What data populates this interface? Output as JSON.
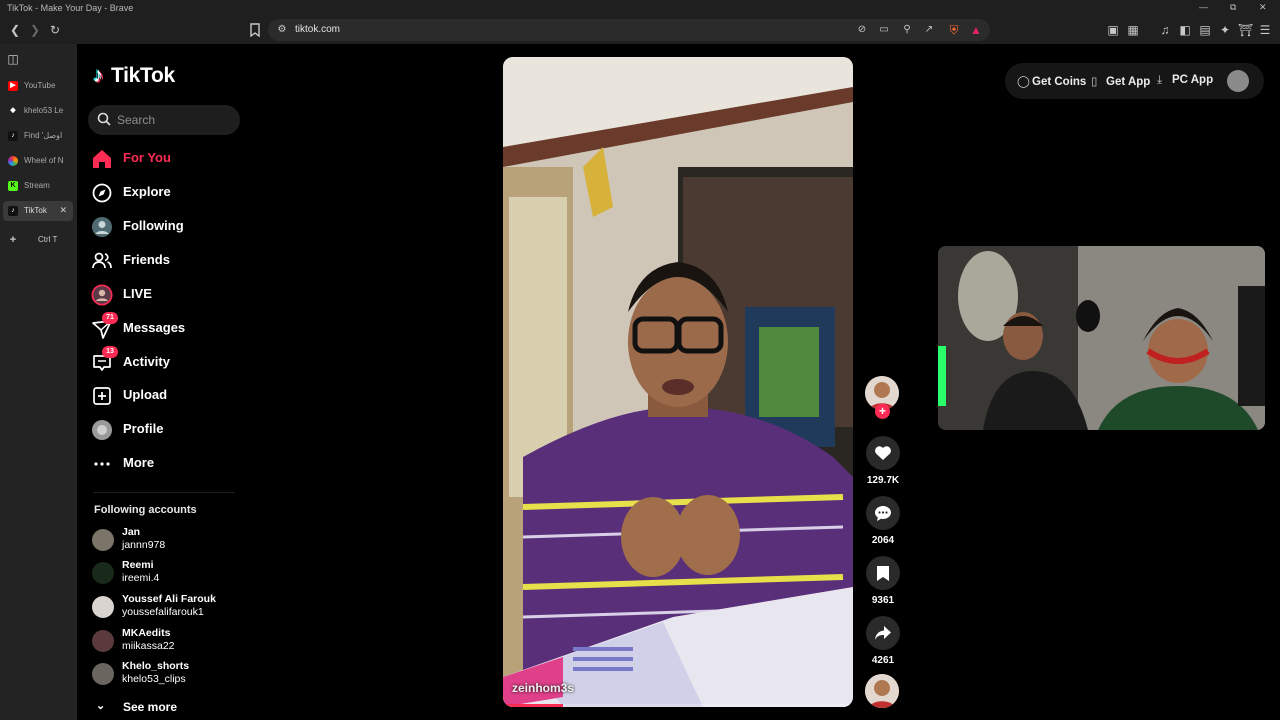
{
  "window": {
    "title": "TikTok - Make Your Day - Brave"
  },
  "browser": {
    "url": "tiktok.com",
    "tabs": [
      {
        "label": "YouTube",
        "favicon": "youtube-icon",
        "color": "#ff0000"
      },
      {
        "label": "khelo53 Le",
        "favicon": "diamond-icon",
        "color": "#ffffff"
      },
      {
        "label": "Find 'اوصل",
        "favicon": "tiktok-icon",
        "color": "#000000"
      },
      {
        "label": "Wheel of N",
        "favicon": "wheel-icon",
        "color": "#ff9800"
      },
      {
        "label": "Stream",
        "favicon": "kick-icon",
        "color": "#53fc18"
      },
      {
        "label": "TikTok",
        "favicon": "tiktok-icon",
        "color": "#000000",
        "active": true
      }
    ],
    "new_tab": {
      "plus": "+",
      "shortcut": "Ctrl T"
    }
  },
  "sidebar": {
    "logo": "TikTok",
    "search_placeholder": "Search",
    "nav": [
      {
        "label": "For You",
        "icon": "home-icon",
        "active": true
      },
      {
        "label": "Explore",
        "icon": "compass-icon"
      },
      {
        "label": "Following",
        "icon": "following-avatar-icon"
      },
      {
        "label": "Friends",
        "icon": "friends-icon"
      },
      {
        "label": "LIVE",
        "icon": "live-icon"
      },
      {
        "label": "Messages",
        "icon": "messages-icon",
        "badge": "71"
      },
      {
        "label": "Activity",
        "icon": "activity-icon",
        "badge": "13"
      },
      {
        "label": "Upload",
        "icon": "upload-icon"
      },
      {
        "label": "Profile",
        "icon": "profile-avatar-icon"
      },
      {
        "label": "More",
        "icon": "more-icon"
      }
    ],
    "following_title": "Following accounts",
    "following": [
      {
        "name": "Jan",
        "handle": "jannn978",
        "color": "#7b7468"
      },
      {
        "name": "Reemi",
        "handle": "ireemi.4",
        "color": "#1a2a1a"
      },
      {
        "name": "Youssef Ali Farouk",
        "handle": "youssefalifarouk1",
        "color": "#d9d4cf"
      },
      {
        "name": "MKAedits",
        "handle": "miikassa22",
        "color": "#5a3a3a"
      },
      {
        "name": "Khelo_shorts",
        "handle": "khelo53_clips",
        "color": "#6b6560"
      }
    ],
    "see_more": "See more"
  },
  "video": {
    "author": "zeinhom3s",
    "progress": 0.17
  },
  "actions": {
    "likes": "129.7K",
    "comments": "2064",
    "saves": "9361",
    "shares": "4261"
  },
  "topbar": {
    "get_coins": "Get Coins",
    "get_app": "Get App",
    "pc_app": "PC App"
  },
  "colors": {
    "accent": "#fe2c55",
    "cyan": "#25f4ee"
  }
}
